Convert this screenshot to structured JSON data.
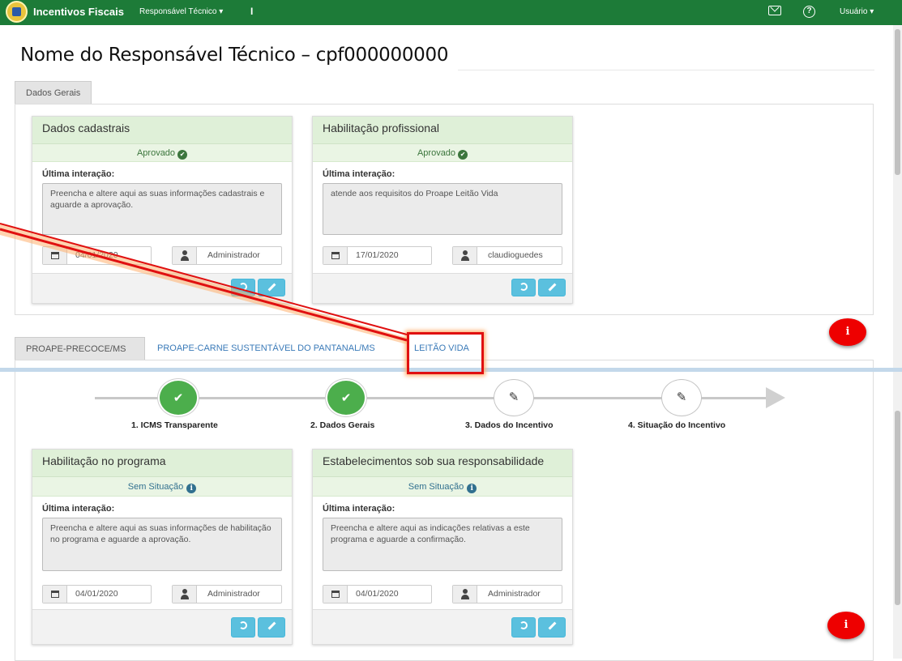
{
  "navbar": {
    "brand": "Incentivos Fiscais",
    "menu": "Responsável Técnico ▾",
    "separator": "I",
    "help_icon_text": "?",
    "user": "Usuário ▾"
  },
  "page": {
    "title": "Nome do Responsável Técnico – cpf000000000"
  },
  "top_tabs": {
    "active": "Dados Gerais"
  },
  "top_cards": [
    {
      "title": "Dados cadastrais",
      "status": "Aprovado",
      "interaction_label": "Última interação:",
      "interaction_text": "Preencha e altere aqui as suas informações cadastrais e aguarde a aprovação.",
      "date": "04/01/2020",
      "user": "Administrador"
    },
    {
      "title": "Habilitação profissional",
      "status": "Aprovado",
      "interaction_label": "Última interação:",
      "interaction_text": "atende aos requisitos do Proape Leitão Vida",
      "date": "17/01/2020",
      "user": "claudioguedes"
    }
  ],
  "program_tabs": {
    "active": "PROAPE-PRECOCE/MS",
    "tab2": "PROAPE-CARNE SUSTENTÁVEL DO PANTANAL/MS",
    "tab3": "LEITÃO VIDA"
  },
  "stepper": {
    "steps": [
      {
        "label": "1. ICMS Transparente",
        "state": "done",
        "icon": "✔"
      },
      {
        "label": "2. Dados Gerais",
        "state": "done",
        "icon": "✔"
      },
      {
        "label": "3. Dados do Incentivo",
        "state": "edit",
        "icon": "✎"
      },
      {
        "label": "4. Situação do Incentivo",
        "state": "edit",
        "icon": "✎"
      }
    ]
  },
  "bottom_cards": [
    {
      "title": "Habilitação no programa",
      "status": "Sem Situação",
      "interaction_label": "Última interação:",
      "interaction_text": "Preencha e altere aqui as suas informações de habilitação no programa e aguarde a aprovação.",
      "date": "04/01/2020",
      "user": "Administrador"
    },
    {
      "title": "Estabelecimentos sob sua responsabilidade",
      "status": "Sem Situação",
      "interaction_label": "Última interação:",
      "interaction_text": "Preencha e altere aqui as indicações relativas a este programa e aguarde a confirmação.",
      "date": "04/01/2020",
      "user": "Administrador"
    }
  ],
  "fab": {
    "icon_text": "i"
  },
  "colors": {
    "navbar": "#1d7b38",
    "card_header": "#dff0d8",
    "button_info": "#5bc0de",
    "fab": "#ee0000",
    "annotation": "#e01010"
  }
}
